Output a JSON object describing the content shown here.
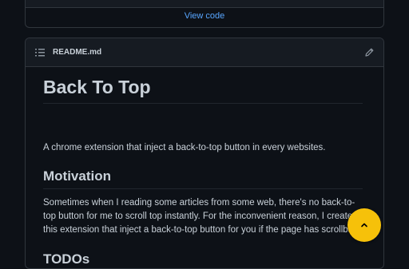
{
  "top_panel": {
    "view_code_label": "View code"
  },
  "readme": {
    "filename": "README.md",
    "title": "Back To Top",
    "description": "A chrome extension that inject a back-to-top button in every websites.",
    "motivation_heading": "Motivation",
    "motivation_text": "Sometimes when I reading some articles from some web, there's no back-to-top button for me to scroll top instantly. For the inconvenient reason, I create this extension that inject a back-to-top button for you if the page has scrollbar.",
    "todos_heading": "TODOs"
  },
  "colors": {
    "background": "#0d1117",
    "link": "#58a6ff",
    "fab": "#f6c10a"
  },
  "icons": {
    "list": "list-icon",
    "edit": "pencil-icon",
    "fab": "chevron-up-icon"
  }
}
